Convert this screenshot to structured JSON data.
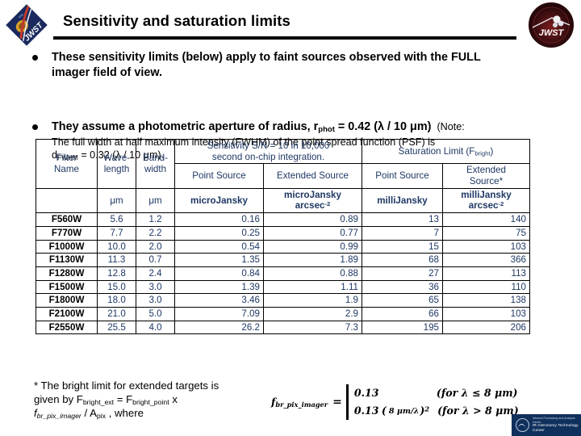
{
  "slide": {
    "title": "Sensitivity and saturation limits",
    "logo_left": "jwst-diamond-logo",
    "logo_right": "jwst-circular-mission-patch"
  },
  "bullets": [
    {
      "main_line1": "These sensitivity limits (below) apply to faint sources observed with the FULL",
      "main_line2": "imager field of view."
    },
    {
      "main_pre": "They assume a photometric aperture of radius, r",
      "main_sub": "phot",
      "main_post": " = 0.42 (λ / 10 μm)",
      "note_open": "(Note:",
      "note_line1": "The full width at half maximum intensity (FWHM) of the point spread function (PSF) is",
      "note_pre": "d",
      "note_sub": "FWHM",
      "note_post": " = 0.32 (λ / 10 μm)."
    }
  ],
  "table": {
    "header": {
      "filter_name_l1": "Filter",
      "filter_name_l2": "Name",
      "wavelength_l1": "Wave-",
      "wavelength_l2": "length",
      "bandwidth_l1": "Band-",
      "bandwidth_l2": "width",
      "sensitivity_l1": "Sensitivity S/N = 10 in 10,000",
      "sensitivity_l2": "second on-chip integration.",
      "saturation_pre": "Saturation Limit (F",
      "saturation_sub": "bright",
      "saturation_post": ")",
      "sens_point": "Point Source",
      "sens_extended": "Extended Source",
      "sat_point": "Point Source",
      "sat_extended_l1": "Extended",
      "sat_extended_l2": "Source*"
    },
    "units": {
      "wavelength": "μm",
      "bandwidth": "μm",
      "sens_point": "microJansky",
      "sens_extended_l1": "microJansky",
      "sens_extended_l2": "arcsec",
      "sens_extended_sup": "-2",
      "sat_point": "milliJansky",
      "sat_extended_l1": "milliJansky",
      "sat_extended_l2": "arcsec",
      "sat_extended_sup": "-2"
    },
    "rows": [
      {
        "filter": "F560W",
        "wavelength": "5.6",
        "bandwidth": "1.2",
        "sens_point": "0.16",
        "sens_ext": "0.89",
        "sat_point": "13",
        "sat_ext": "140"
      },
      {
        "filter": "F770W",
        "wavelength": "7.7",
        "bandwidth": "2.2",
        "sens_point": "0.25",
        "sens_ext": "0.77",
        "sat_point": "7",
        "sat_ext": "75"
      },
      {
        "filter": "F1000W",
        "wavelength": "10.0",
        "bandwidth": "2.0",
        "sens_point": "0.54",
        "sens_ext": "0.99",
        "sat_point": "15",
        "sat_ext": "103"
      },
      {
        "filter": "F1130W",
        "wavelength": "11.3",
        "bandwidth": "0.7",
        "sens_point": "1.35",
        "sens_ext": "1.89",
        "sat_point": "68",
        "sat_ext": "366"
      },
      {
        "filter": "F1280W",
        "wavelength": "12.8",
        "bandwidth": "2.4",
        "sens_point": "0.84",
        "sens_ext": "0.88",
        "sat_point": "27",
        "sat_ext": "113"
      },
      {
        "filter": "F1500W",
        "wavelength": "15.0",
        "bandwidth": "3.0",
        "sens_point": "1.39",
        "sens_ext": "1.11",
        "sat_point": "36",
        "sat_ext": "110"
      },
      {
        "filter": "F1800W",
        "wavelength": "18.0",
        "bandwidth": "3.0",
        "sens_point": "3.46",
        "sens_ext": "1.9",
        "sat_point": "65",
        "sat_ext": "138"
      },
      {
        "filter": "F2100W",
        "wavelength": "21.0",
        "bandwidth": "5.0",
        "sens_point": "7.09",
        "sens_ext": "2.9",
        "sat_point": "66",
        "sat_ext": "103"
      },
      {
        "filter": "F2550W",
        "wavelength": "25.5",
        "bandwidth": "4.0",
        "sens_point": "26.2",
        "sens_ext": "7.3",
        "sat_point": "195",
        "sat_ext": "206"
      }
    ]
  },
  "footnote": {
    "line1": "* The bright limit for extended targets is",
    "line2_pre": "given by F",
    "line2_sub1": "bright_ext",
    "line2_mid": " = F",
    "line2_sub2": "bright_point",
    "line2_post": " x",
    "line3_pre": "f",
    "line3_sub1": "br_pix_imager",
    "line3_mid": " / A",
    "line3_sub2": "pix",
    "line3_post": " , where"
  },
  "equation": {
    "lhs_pre": "f",
    "lhs_sub": "br_pix_imager",
    "equals": "=",
    "row1_value": "0.13",
    "row1_condition": "(for λ ≤ 8 μm)",
    "row2_value": "0.13",
    "row2_frac_num": "8 μm",
    "row2_frac_den": "λ",
    "row2_exp": "2",
    "row2_condition": "(for λ > 8 μm)"
  },
  "bottom_banner": {
    "line1": "Infrared Processing and Analysis Center",
    "line2": "IR Astronomy Technology Center",
    "color": "#10305C"
  }
}
